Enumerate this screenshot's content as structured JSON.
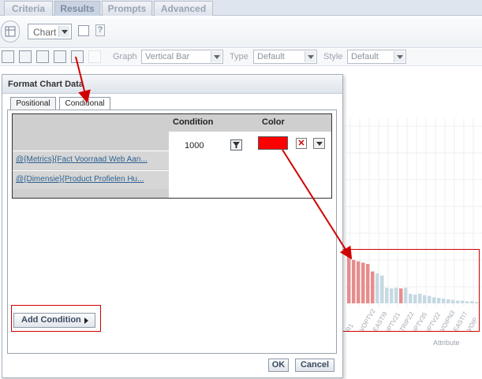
{
  "top_tabs": [
    "Criteria",
    "Results",
    "Prompts",
    "Advanced"
  ],
  "view_toolbar": {
    "view_type": "Chart"
  },
  "chart_toolbar": {
    "graph_label": "Graph",
    "graph_value": "Vertical Bar",
    "type_label": "Type",
    "type_value": "Default",
    "style_label": "Style",
    "style_value": "Default"
  },
  "dialog": {
    "title": "Format Chart Data",
    "tabs": [
      "Positional",
      "Conditional"
    ],
    "active_tab": "Conditional",
    "table": {
      "headers": {
        "condition": "Condition",
        "color": "Color"
      },
      "rows": [
        "@{Metrics}{Fact Voorraad Web Aan...",
        "@{Dimensie}{Product Profielen Hu..."
      ],
      "condition_value": "1000",
      "color_value": "#ff0000"
    },
    "add_condition": "Add Condition",
    "ok": "OK",
    "cancel": "Cancel"
  },
  "background_chart": {
    "x_axis_title": "Attribute",
    "tick_labels": [
      "R1",
      "VOPTV2",
      "EASTI9",
      "IPTV21",
      "TRIPZ2",
      "IPTV35",
      "IPTV22",
      "VOIPN3",
      "EASTI7",
      "VOIP"
    ],
    "bar_values": [
      0.72,
      0.64,
      0.62,
      0.6,
      0.58,
      0.47,
      0.44,
      0.41,
      0.23,
      0.22,
      0.23,
      0.22,
      0.23,
      0.14,
      0.13,
      0.14,
      0.12,
      0.11,
      0.09,
      0.08,
      0.07,
      0.06,
      0.05,
      0.04,
      0.04,
      0.03,
      0.03,
      0.02
    ]
  },
  "colors": {
    "highlight_bar": "#e78c8c",
    "normal_bar": "#c5d9e2",
    "annotation": "#d00000"
  }
}
